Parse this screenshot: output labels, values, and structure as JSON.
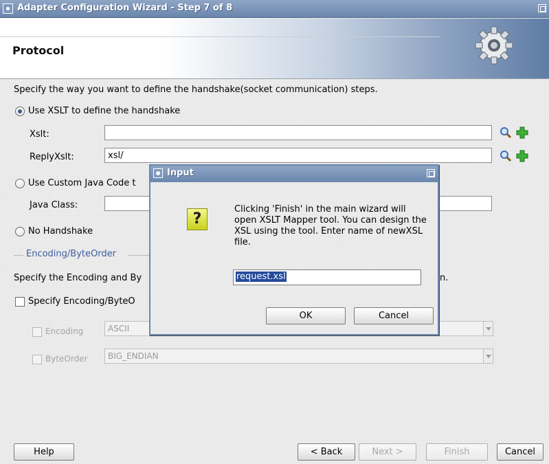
{
  "window": {
    "title": "Adapter Configuration Wizard - Step 7 of 8"
  },
  "header": {
    "title": "Protocol"
  },
  "main": {
    "description": "Specify the way you want to define the handshake(socket communication) steps.",
    "option_xslt": "Use XSLT to define the handshake",
    "xslt_label": "Xslt:",
    "xslt_value": "",
    "reply_xslt_label": "ReplyXslt:",
    "reply_xslt_value": "xsl/",
    "option_custom_java": "Use Custom Java Code t",
    "java_class_label": "Java Class:",
    "java_class_value": "",
    "option_no_handshake": "No Handshake",
    "encoding_section_label": "Encoding/ByteOrder",
    "encoding_desc_left": "Specify the Encoding and By",
    "encoding_desc_right": "n.",
    "specify_encoding_label": "Specify Encoding/ByteO",
    "encoding_label": "Encoding",
    "encoding_value": "ASCII",
    "byteorder_label": "ByteOrder",
    "byteorder_value": "BIG_ENDIAN"
  },
  "footer": {
    "help": "Help",
    "back": "< Back",
    "next": "Next >",
    "finish": "Finish",
    "cancel": "Cancel"
  },
  "dialog": {
    "title": "Input",
    "message": "Clicking 'Finish' in the main wizard will open XSLT Mapper tool. You can design the XSL using the tool. Enter name of newXSL file.",
    "input_value": "request.xsl",
    "ok": "OK",
    "cancel": "Cancel"
  },
  "colors": {
    "titlebar": "#6a86ad",
    "link": "#3c5ea0",
    "selection": "#244a9a"
  }
}
